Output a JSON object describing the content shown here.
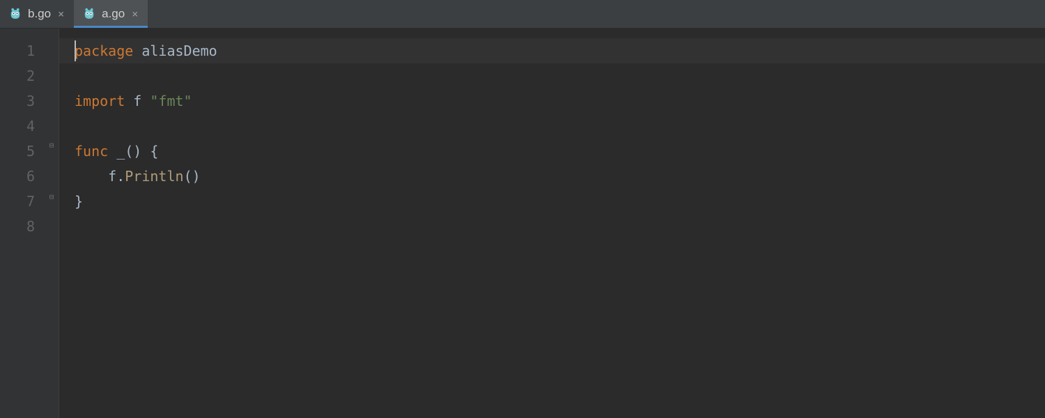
{
  "tabs": [
    {
      "label": "b.go",
      "active": false
    },
    {
      "label": "a.go",
      "active": true
    }
  ],
  "gutter": {
    "lines": [
      "1",
      "2",
      "3",
      "4",
      "5",
      "6",
      "7",
      "8"
    ]
  },
  "code": {
    "line1": {
      "kw": "package",
      "sp": " ",
      "ident": "aliasDemo"
    },
    "line3": {
      "kw": "import",
      "sp1": " ",
      "alias": "f",
      "sp2": " ",
      "str": "\"fmt\""
    },
    "line5": {
      "kw": "func",
      "sp": " ",
      "name": "_",
      "parens": "()",
      "sp2": " ",
      "brace": "{"
    },
    "line6": {
      "indent": "    ",
      "recv": "f",
      "dot": ".",
      "call": "Println",
      "parens": "()"
    },
    "line7": {
      "brace": "}"
    }
  },
  "fold": {
    "open_glyph": "⊟",
    "close_glyph": "⊟"
  },
  "close_glyph": "×"
}
